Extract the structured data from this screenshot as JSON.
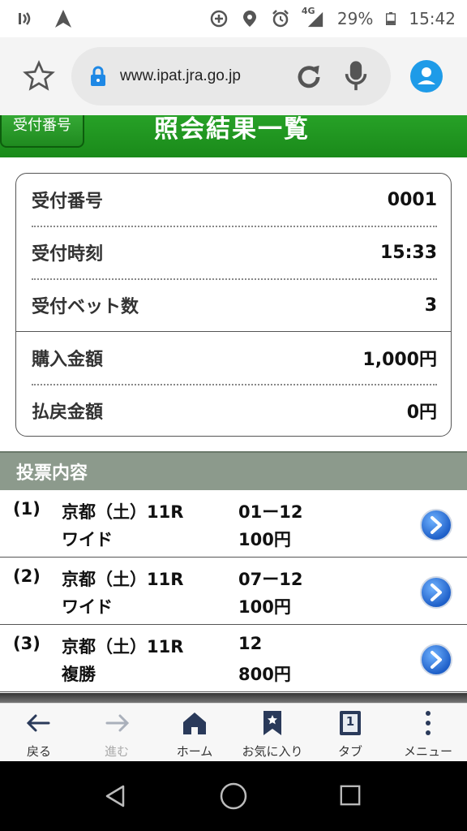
{
  "statusbar": {
    "network": "4G",
    "battery": "29%",
    "time": "15:42"
  },
  "browser": {
    "url": "www.ipat.jra.go.jp"
  },
  "header": {
    "back_label": "受付番号",
    "title": "照会結果一覧"
  },
  "summary": {
    "rows": [
      {
        "label": "受付番号",
        "value": "0001"
      },
      {
        "label": "受付時刻",
        "value": "15:33"
      },
      {
        "label": "受付ベット数",
        "value": "3"
      },
      {
        "label": "購入金額",
        "value": "1,000円"
      },
      {
        "label": "払戻金額",
        "value": "0円"
      }
    ]
  },
  "section": {
    "title": "投票内容"
  },
  "bets": [
    {
      "num": "(1)",
      "race": "京都（土）11R",
      "type": "ワイド",
      "combo": "01ー12",
      "amount": "100円"
    },
    {
      "num": "(2)",
      "race": "京都（土）11R",
      "type": "ワイド",
      "combo": "07ー12",
      "amount": "100円"
    },
    {
      "num": "(3)",
      "race": "京都（土）11R",
      "type": "複勝",
      "combo": "12",
      "amount": "800円"
    }
  ],
  "bottomnav": {
    "items": [
      {
        "label": "戻る",
        "icon": "arrow-left-icon"
      },
      {
        "label": "進む",
        "icon": "arrow-right-icon"
      },
      {
        "label": "ホーム",
        "icon": "home-icon"
      },
      {
        "label": "お気に入り",
        "icon": "bookmark-icon"
      },
      {
        "label": "タブ",
        "icon": "tabs-icon",
        "badge": "1"
      },
      {
        "label": "メニュー",
        "icon": "menu-dots-icon"
      }
    ]
  },
  "colors": {
    "header_green": "#1a8a1a",
    "section_gray": "#8c9a8c",
    "link_blue": "#2a73d6",
    "account_blue": "#1e9be8"
  }
}
